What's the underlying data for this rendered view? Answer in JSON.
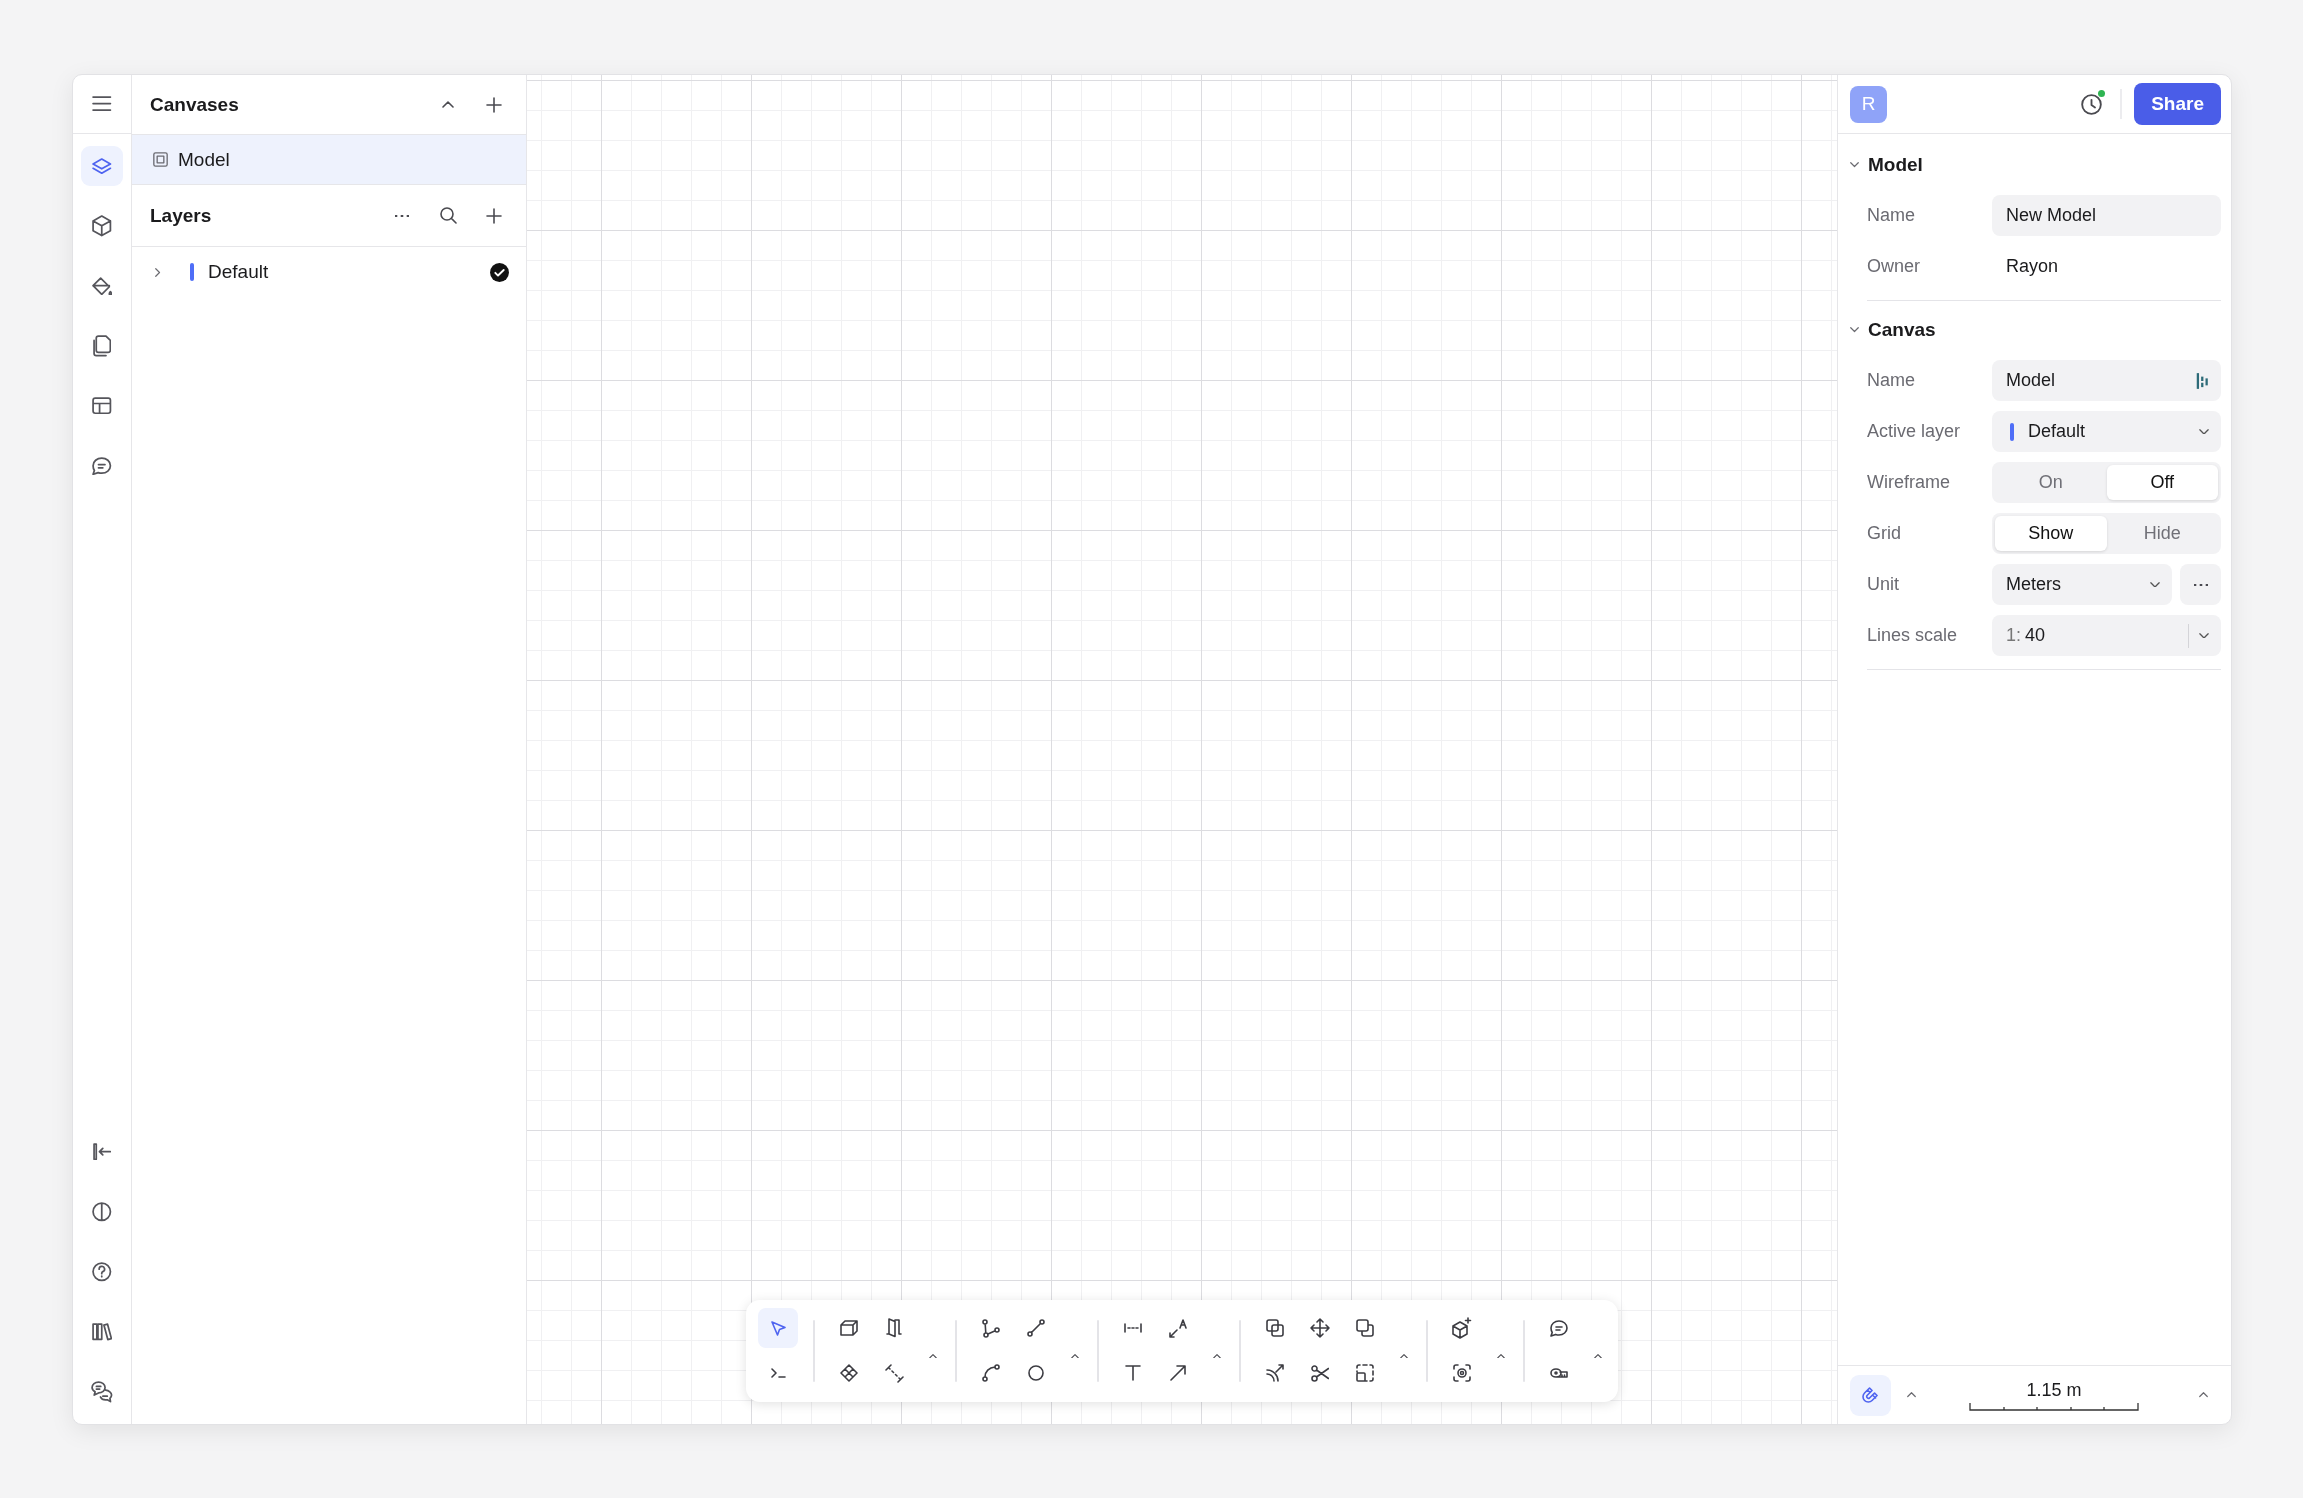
{
  "rail": {
    "top": [
      {
        "kind": "menu",
        "selected": false
      },
      {
        "kind": "layers",
        "selected": true
      },
      {
        "kind": "cube",
        "selected": false
      },
      {
        "kind": "bucket",
        "selected": false
      },
      {
        "kind": "pages",
        "selected": false
      },
      {
        "kind": "table",
        "selected": false
      },
      {
        "kind": "comment",
        "selected": false
      }
    ],
    "bottom": [
      {
        "kind": "collapse",
        "selected": false
      },
      {
        "kind": "contrast",
        "selected": false
      },
      {
        "kind": "help",
        "selected": false
      },
      {
        "kind": "library",
        "selected": false
      },
      {
        "kind": "chats",
        "selected": false
      }
    ]
  },
  "canvases": {
    "title": "Canvases",
    "expanded": true,
    "items": [
      {
        "label": "Model",
        "selected": true
      }
    ]
  },
  "layers": {
    "title": "Layers",
    "items": [
      {
        "name": "Default",
        "color": "#4f6ef7",
        "expanded": false,
        "active": true
      }
    ]
  },
  "header": {
    "avatar": "R",
    "share": "Share",
    "history_unread": true
  },
  "properties": [
    {
      "title": "Model",
      "expanded": true,
      "rows": [
        {
          "kind": "field",
          "label": "Name",
          "value": "New Model"
        },
        {
          "kind": "text",
          "label": "Owner",
          "value": "Rayon"
        }
      ]
    },
    {
      "title": "Canvas",
      "expanded": true,
      "rows": [
        {
          "kind": "field_logo",
          "label": "Name",
          "value": "Model"
        },
        {
          "kind": "select",
          "label": "Active layer",
          "value": "Default",
          "color": "#4f6ef7"
        },
        {
          "kind": "segmented",
          "label": "Wireframe",
          "options": [
            {
              "label": "On",
              "selected": false
            },
            {
              "label": "Off",
              "selected": true
            }
          ]
        },
        {
          "kind": "segmented",
          "label": "Grid",
          "options": [
            {
              "label": "Show",
              "selected": true
            },
            {
              "label": "Hide",
              "selected": false
            }
          ]
        },
        {
          "kind": "select_more",
          "label": "Unit",
          "value": "Meters"
        },
        {
          "kind": "scale",
          "label": "Lines scale",
          "prefix": "1:",
          "value": "40"
        }
      ]
    }
  ],
  "toolbar": [
    {
      "top": [
        {
          "kind": "select",
          "selected": true
        }
      ],
      "bottom": [
        {
          "kind": "terminal",
          "selected": false
        }
      ],
      "more": false
    },
    {
      "top": [
        {
          "kind": "box",
          "selected": false
        },
        {
          "kind": "door",
          "selected": false
        }
      ],
      "bottom": [
        {
          "kind": "plane",
          "selected": false
        },
        {
          "kind": "measure",
          "selected": false
        }
      ],
      "more": true
    },
    {
      "top": [
        {
          "kind": "polyline",
          "selected": false
        },
        {
          "kind": "line",
          "selected": false
        }
      ],
      "bottom": [
        {
          "kind": "arc",
          "selected": false
        },
        {
          "kind": "circle",
          "selected": false
        }
      ],
      "more": true
    },
    {
      "top": [
        {
          "kind": "dimension",
          "selected": false
        },
        {
          "kind": "label",
          "selected": false
        }
      ],
      "bottom": [
        {
          "kind": "text",
          "selected": false
        },
        {
          "kind": "arrow",
          "selected": false
        }
      ],
      "more": true
    },
    {
      "top": [
        {
          "kind": "copy",
          "selected": false
        },
        {
          "kind": "move",
          "selected": false
        },
        {
          "kind": "overlap",
          "selected": false
        }
      ],
      "bottom": [
        {
          "kind": "offset",
          "selected": false
        },
        {
          "kind": "scissors",
          "selected": false
        },
        {
          "kind": "dashed",
          "selected": false
        }
      ],
      "more": true
    },
    {
      "top": [
        {
          "kind": "cubeplus",
          "selected": false
        }
      ],
      "bottom": [
        {
          "kind": "scan",
          "selected": false
        }
      ],
      "more": true
    },
    {
      "top": [
        {
          "kind": "comment",
          "selected": false
        }
      ],
      "bottom": [
        {
          "kind": "tape",
          "selected": false
        }
      ],
      "more": true
    }
  ],
  "status": {
    "snap": true,
    "scale": "1.15 m"
  }
}
